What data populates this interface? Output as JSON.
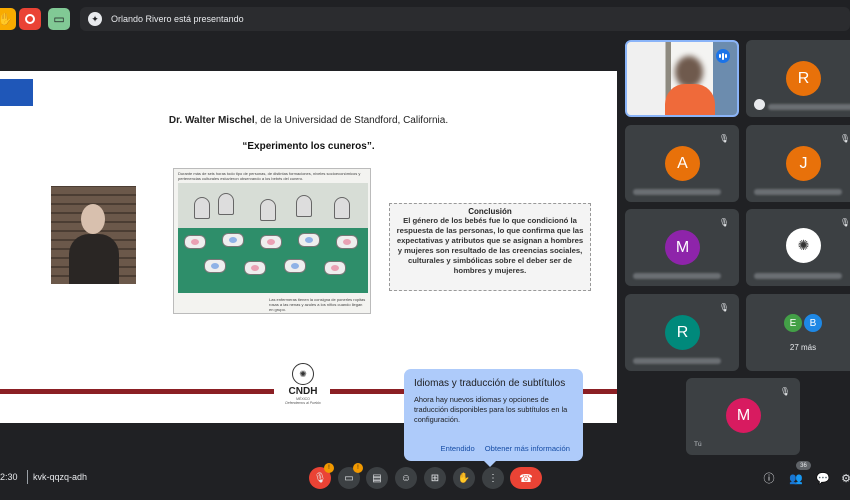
{
  "top_bar": {
    "presenting_text": "Orlando Rivero está presentando"
  },
  "slide": {
    "title_bold": "Dr. Walter Mischel",
    "title_rest": ", de la Universidad de Standford, California.",
    "subtitle": "“Experimento los cuneros”.",
    "comic_caption_top": "Durante más de seis horas todo tipo de personas, de distintas formaciones, niveles socioeconómicos y pertenencias culturales estuvieron observando a los bebés del cunero.",
    "comic_caption_bottom": "Las enfermeras tienen la consigna de ponerles ropitas rosas a las nenas y azules a los niños cuando llegan en grupo.",
    "conclusion_title": "Conclusión",
    "conclusion_body": "El género de los bebés fue lo que condicionó la respuesta de las personas, lo que confirma que las expectativas y atributos que se asignan a hombres y mujeres son resultado de las creencias sociales, culturales y simbólicas sobre el deber ser de hombres y mujeres.",
    "logo_text": "CNDH",
    "logo_subtext": "MÉXICO",
    "logo_tagline": "Defendemos al Pueblo"
  },
  "tooltip": {
    "title": "Idiomas y traducción de subtítulos",
    "body": "Ahora hay nuevos idiomas y opciones de traducción disponibles para los subtítulos en la configuración.",
    "action_ok": "Entendido",
    "action_more": "Obtener más información"
  },
  "participants": [
    {
      "initial": "R",
      "color": "#e8710a"
    },
    {
      "initial": "A",
      "color": "#e8710a"
    },
    {
      "initial": "J",
      "color": "#e8710a"
    },
    {
      "initial": "M",
      "color": "#8e24aa"
    },
    {
      "initial": "R",
      "color": "#00897b"
    },
    {
      "initial": "M",
      "color": "#d81b60",
      "name": "Tú"
    }
  ],
  "more_tile": {
    "avatars": [
      {
        "initial": "E",
        "color": "#43a047"
      },
      {
        "initial": "B",
        "color": "#1e88e5"
      }
    ],
    "label": "27 más"
  },
  "bottom_bar": {
    "time": "2:30",
    "meeting_code": "kvk-qqzq-adh",
    "people_count": "36",
    "mic_badge": "!",
    "cam_badge": "!"
  },
  "icons": {
    "mic_off": "mic-off-icon",
    "camera_off": "camera-off-icon",
    "captions": "captions-icon",
    "emoji": "emoji-icon",
    "present": "present-icon",
    "raise_hand": "raise-hand-icon",
    "more": "more-vert-icon",
    "hang_up": "phone-hangup-icon",
    "info": "info-icon",
    "people": "people-icon",
    "chat": "chat-icon",
    "activities": "activities-icon"
  },
  "colors": {
    "background": "#202124",
    "tile": "#3c4043",
    "tooltip": "#aecbfa",
    "hangup": "#ea4335",
    "slide_accent_blue": "#1f57b8",
    "slide_accent_red": "#8b1f24"
  }
}
